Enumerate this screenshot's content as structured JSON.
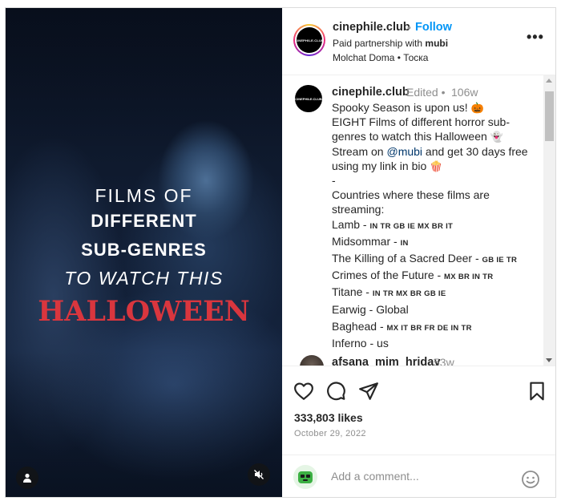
{
  "post": {
    "media": {
      "title_lines": [
        "FILMS OF",
        "DIFFERENT",
        "SUB-GENRES",
        "TO WATCH THIS",
        "HALLOWEEN"
      ],
      "title_accent_color": "#d9363e",
      "icons": {
        "user_tag": "user-tag-icon",
        "mute": "speaker-muted-icon"
      }
    },
    "header": {
      "avatar_text": "CINEPHILE.CLUB",
      "username": "cinephile.club",
      "separator": "•",
      "follow_label": "Follow",
      "partnership_prefix": "Paid partnership with ",
      "partner": "mubi",
      "audio": "Molchat Doma • Тоска",
      "more_label": "•••"
    },
    "caption": {
      "username": "cinephile.club",
      "edited_label": "Edited •",
      "time": "106w",
      "lines": {
        "l1": "Spooky Season is upon us!",
        "l2": "EIGHT Films of different horror sub-",
        "l3": "genres to watch this Halloween",
        "l4_pre": "Stream on ",
        "l4_mention": "@mubi",
        "l4_post": " and get 30 days free",
        "l5": "using my link in bio",
        "l6": "-",
        "l7": "Countries where these films are",
        "l8": "streaming:"
      },
      "films": [
        {
          "title": "Lamb - ",
          "countries": "IN TR GB IE MX BR IT"
        },
        {
          "title": "Midsommar - ",
          "countries": "IN"
        },
        {
          "title": "The Killing of a Sacred Deer - ",
          "countries": "GB IE TR"
        },
        {
          "title": "Crimes of the Future - ",
          "countries": "MX BR IN TR"
        },
        {
          "title": "Titane - ",
          "countries": "IN TR MX BR GB IE"
        },
        {
          "title": "Earwig - Global",
          "countries": ""
        },
        {
          "title": "Baghead - ",
          "countries": "MX IT BR FR DE IN TR"
        },
        {
          "title": "Inferno - us",
          "countries": ""
        }
      ],
      "emojis": {
        "pumpkin": "🎃",
        "ghost": "👻",
        "popcorn": "🍿"
      }
    },
    "comments": [
      {
        "username": "afsana_mim_hriday",
        "time": "53w"
      }
    ],
    "actions": {
      "icons": {
        "like": "heart-icon",
        "comment": "comment-bubble-icon",
        "share": "paper-plane-icon",
        "save": "bookmark-icon"
      },
      "likes": "333,803 likes",
      "date": "October 29, 2022"
    },
    "add_comment": {
      "placeholder": "Add a comment...",
      "icons": {
        "avatar": "emoji-avatar-icon",
        "emoji": "smiley-icon"
      }
    },
    "colors": {
      "link": "#0095f6",
      "mention": "#00376b",
      "muted": "#8e8e8e",
      "text": "#262626"
    }
  }
}
